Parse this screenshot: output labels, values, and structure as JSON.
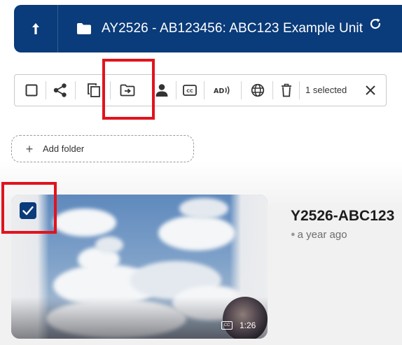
{
  "header": {
    "title": "AY2526 - AB123456: ABC123 Example Unit",
    "up_icon": "arrow-up-icon",
    "folder_icon": "folder-icon",
    "refresh_icon": "refresh-icon"
  },
  "toolbar": {
    "buttons": [
      {
        "name": "select-all-checkbox",
        "icon": "checkbox-empty-icon"
      },
      {
        "name": "share-button",
        "icon": "share-icon"
      },
      {
        "name": "copy-button",
        "icon": "copy-icon"
      },
      {
        "name": "move-button",
        "icon": "move-to-folder-icon"
      },
      {
        "name": "owner-button",
        "icon": "person-icon"
      },
      {
        "name": "captions-button",
        "icon": "cc-icon"
      },
      {
        "name": "audio-description-button",
        "icon": "audio-description-icon"
      },
      {
        "name": "publish-button",
        "icon": "globe-icon"
      },
      {
        "name": "delete-button",
        "icon": "trash-icon"
      }
    ],
    "cc_text": "CC",
    "ad_text": "AD",
    "selected_count": "1 selected",
    "close_icon": "close-icon"
  },
  "add_folder": {
    "plus": "+",
    "label": "Add folder"
  },
  "video": {
    "title": "Y2526-ABC123",
    "meta": "a year ago",
    "duration": "1:26",
    "cc_badge": "CC",
    "checked": true
  },
  "colors": {
    "brand": "#0a3b7a",
    "highlight": "#e0141e",
    "text": "#1c1c1c",
    "muted": "#6d6d6d"
  }
}
